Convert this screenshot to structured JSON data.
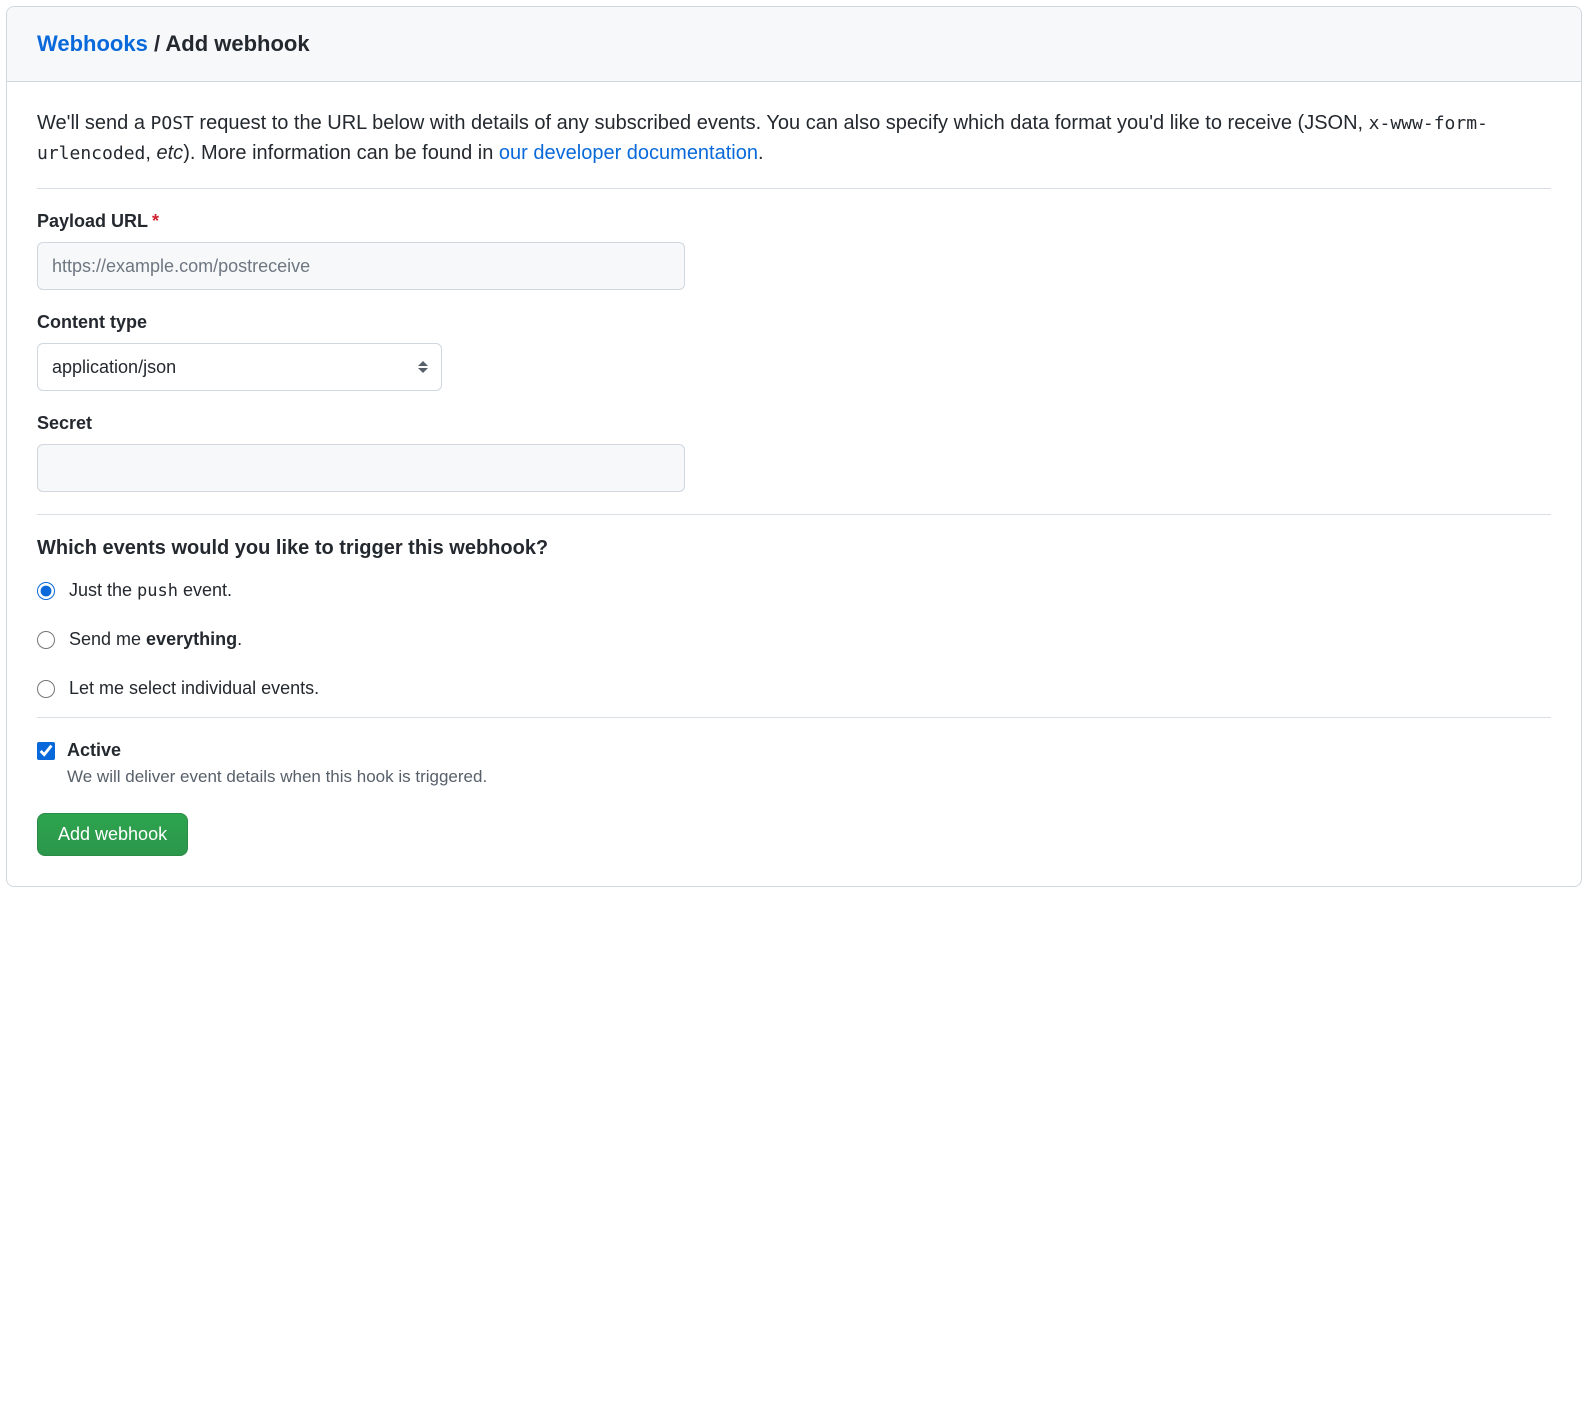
{
  "breadcrumb": {
    "link_text": "Webhooks",
    "separator": "/",
    "current": "Add webhook"
  },
  "description": {
    "part1": "We'll send a ",
    "code1": "POST",
    "part2": " request to the URL below with details of any subscribed events. You can also specify which data format you'd like to receive (JSON, ",
    "code2": "x-www-form-urlencoded",
    "part3": ", ",
    "em": "etc",
    "part4": "). More information can be found in ",
    "link_text": "our developer documentation",
    "part5": "."
  },
  "fields": {
    "payload_url": {
      "label": "Payload URL",
      "required_marker": "*",
      "placeholder": "https://example.com/postreceive",
      "value": ""
    },
    "content_type": {
      "label": "Content type",
      "selected": "application/json"
    },
    "secret": {
      "label": "Secret",
      "value": ""
    }
  },
  "events": {
    "heading": "Which events would you like to trigger this webhook?",
    "options": {
      "push": {
        "pre": "Just the ",
        "code": "push",
        "post": " event.",
        "checked": true
      },
      "everything": {
        "pre": "Send me ",
        "strong": "everything",
        "post": ".",
        "checked": false
      },
      "individual": {
        "text": "Let me select individual events.",
        "checked": false
      }
    }
  },
  "active": {
    "label": "Active",
    "description": "We will deliver event details when this hook is triggered.",
    "checked": true
  },
  "submit": {
    "label": "Add webhook"
  }
}
